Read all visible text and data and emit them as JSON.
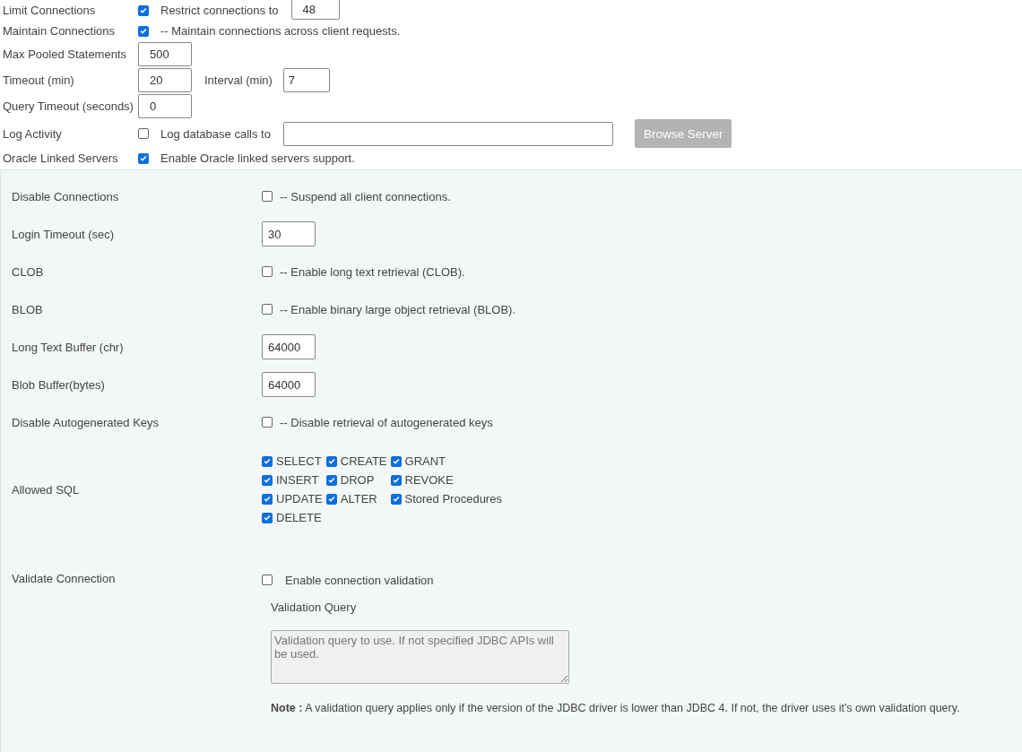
{
  "top_rows": [
    {
      "kind": "check_field",
      "label": "Limit Connections",
      "checked": true,
      "text": "Restrict connections to",
      "value": "48"
    },
    {
      "kind": "check_text",
      "label": "Maintain Connections",
      "checked": true,
      "text": "-- Maintain connections across client requests."
    },
    {
      "kind": "field",
      "label": "Max Pooled Statements",
      "value": "500"
    },
    {
      "kind": "field2",
      "label": "Timeout (min)",
      "value": "20",
      "text": "Interval (min)",
      "value2": "7"
    },
    {
      "kind": "field",
      "label": "Query Timeout (seconds)",
      "value": "0"
    },
    {
      "kind": "check_path",
      "label": "Log Activity",
      "checked": false,
      "text": "Log database calls to",
      "button": {
        "label": "Browse Server",
        "disabled": true
      }
    },
    {
      "kind": "check_text",
      "label": "Oracle Linked Servers",
      "checked": true,
      "text": "Enable Oracle linked servers support."
    }
  ],
  "panel_rows": [
    {
      "kind": "check_text",
      "label": "Disable Connections",
      "checked": false,
      "text": "-- Suspend all client connections."
    },
    {
      "kind": "field",
      "label": "Login Timeout (sec)",
      "value": "30"
    },
    {
      "kind": "check_text",
      "label": "CLOB",
      "checked": false,
      "text": "-- Enable long text retrieval (CLOB)."
    },
    {
      "kind": "check_text",
      "label": "BLOB",
      "checked": false,
      "text": "-- Enable binary large object retrieval (BLOB)."
    },
    {
      "kind": "field",
      "label": "Long Text Buffer (chr)",
      "value": "64000"
    },
    {
      "kind": "field",
      "label": "Blob Buffer(bytes)",
      "value": "64000"
    },
    {
      "kind": "check_text",
      "label": "Disable Autogenerated Keys",
      "checked": false,
      "text": "-- Disable retrieval of autogenerated keys"
    },
    {
      "kind": "sql",
      "label": "Allowed SQL",
      "options": [
        {
          "label": "SELECT",
          "checked": true
        },
        {
          "label": "CREATE",
          "checked": true
        },
        {
          "label": "GRANT",
          "checked": true
        },
        {
          "label": "INSERT",
          "checked": true
        },
        {
          "label": "DROP",
          "checked": true
        },
        {
          "label": "REVOKE",
          "checked": true
        },
        {
          "label": "UPDATE",
          "checked": true
        },
        {
          "label": "ALTER",
          "checked": true
        },
        {
          "label": "Stored Procedures",
          "checked": true
        },
        {
          "label": "DELETE",
          "checked": true
        }
      ]
    },
    {
      "kind": "validation",
      "label": "Validate Connection",
      "checked": false,
      "text": "Enable connection validation",
      "subheading": "Validation Query",
      "placeholder": "Validation query to use. If not specified JDBC APIs will be used.",
      "disabled": true,
      "note": "**Note :** A validation query applies only if the version of the JDBC driver is lower than JDBC 4. If not, the driver uses it's own validation query."
    }
  ]
}
